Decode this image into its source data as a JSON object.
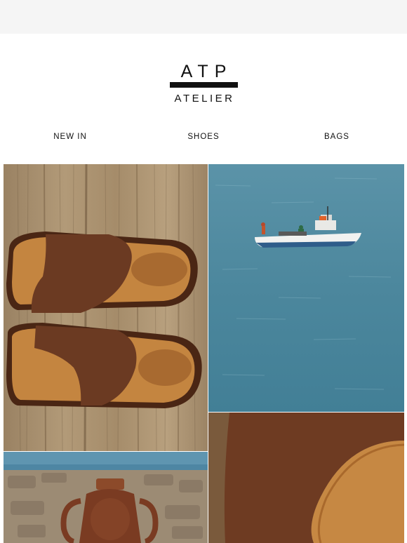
{
  "brand": {
    "logo_top": "ATP",
    "logo_bottom": "ATELIER"
  },
  "nav": {
    "items": [
      {
        "label": "NEW IN"
      },
      {
        "label": "SHOES"
      },
      {
        "label": "BAGS"
      }
    ]
  },
  "colors": {
    "page_bg": "#f5f5f5",
    "card_bg": "#ffffff",
    "ink": "#111111",
    "wood": "#a8906f",
    "sea": "#4f8aa0",
    "suede": "#6b3a22",
    "leather_tan": "#c48540"
  }
}
